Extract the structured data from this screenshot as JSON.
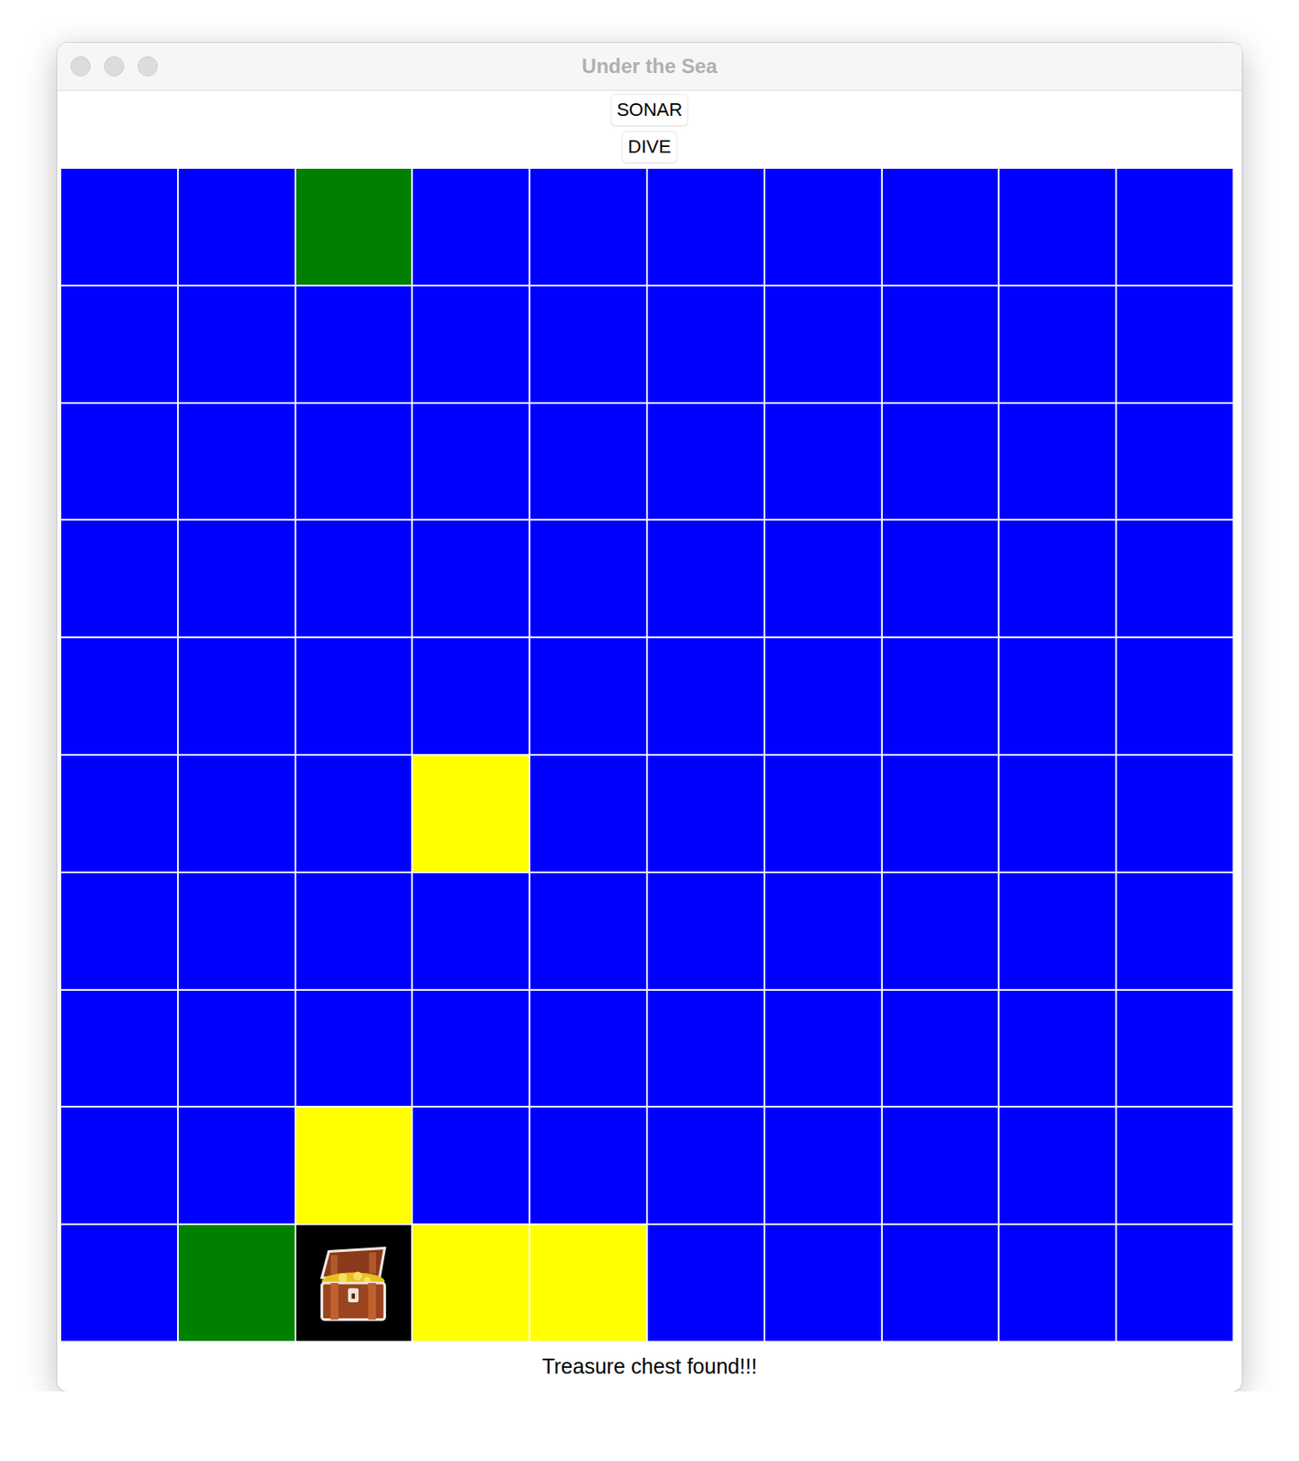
{
  "window": {
    "title": "Under the Sea"
  },
  "buttons": [
    {
      "label": "SONAR"
    },
    {
      "label": "DIVE"
    }
  ],
  "board": {
    "rows": [
      [
        {
          "kind": "water",
          "color": "#0000ff"
        },
        {
          "kind": "water",
          "color": "#0000ff"
        },
        {
          "kind": "water",
          "color": "#008000"
        },
        {
          "kind": "water",
          "color": "#0000ff"
        },
        {
          "kind": "water",
          "color": "#0000ff"
        },
        {
          "kind": "water",
          "color": "#0000ff"
        },
        {
          "kind": "water",
          "color": "#0000ff"
        },
        {
          "kind": "water",
          "color": "#0000ff"
        },
        {
          "kind": "water",
          "color": "#0000ff"
        },
        {
          "kind": "water",
          "color": "#0000ff"
        }
      ],
      [
        {
          "kind": "water",
          "color": "#0000ff"
        },
        {
          "kind": "water",
          "color": "#0000ff"
        },
        {
          "kind": "water",
          "color": "#0000ff"
        },
        {
          "kind": "water",
          "color": "#0000ff"
        },
        {
          "kind": "water",
          "color": "#0000ff"
        },
        {
          "kind": "water",
          "color": "#0000ff"
        },
        {
          "kind": "water",
          "color": "#0000ff"
        },
        {
          "kind": "water",
          "color": "#0000ff"
        },
        {
          "kind": "water",
          "color": "#0000ff"
        },
        {
          "kind": "water",
          "color": "#0000ff"
        }
      ],
      [
        {
          "kind": "water",
          "color": "#0000ff"
        },
        {
          "kind": "water",
          "color": "#0000ff"
        },
        {
          "kind": "water",
          "color": "#0000ff"
        },
        {
          "kind": "water",
          "color": "#0000ff"
        },
        {
          "kind": "water",
          "color": "#0000ff"
        },
        {
          "kind": "water",
          "color": "#0000ff"
        },
        {
          "kind": "water",
          "color": "#0000ff"
        },
        {
          "kind": "water",
          "color": "#0000ff"
        },
        {
          "kind": "water",
          "color": "#0000ff"
        },
        {
          "kind": "water",
          "color": "#0000ff"
        }
      ],
      [
        {
          "kind": "water",
          "color": "#0000ff"
        },
        {
          "kind": "water",
          "color": "#0000ff"
        },
        {
          "kind": "water",
          "color": "#0000ff"
        },
        {
          "kind": "water",
          "color": "#0000ff"
        },
        {
          "kind": "water",
          "color": "#0000ff"
        },
        {
          "kind": "water",
          "color": "#0000ff"
        },
        {
          "kind": "water",
          "color": "#0000ff"
        },
        {
          "kind": "water",
          "color": "#0000ff"
        },
        {
          "kind": "water",
          "color": "#0000ff"
        },
        {
          "kind": "water",
          "color": "#0000ff"
        }
      ],
      [
        {
          "kind": "water",
          "color": "#0000ff"
        },
        {
          "kind": "water",
          "color": "#0000ff"
        },
        {
          "kind": "water",
          "color": "#0000ff"
        },
        {
          "kind": "water",
          "color": "#0000ff"
        },
        {
          "kind": "water",
          "color": "#0000ff"
        },
        {
          "kind": "water",
          "color": "#0000ff"
        },
        {
          "kind": "water",
          "color": "#0000ff"
        },
        {
          "kind": "water",
          "color": "#0000ff"
        },
        {
          "kind": "water",
          "color": "#0000ff"
        },
        {
          "kind": "water",
          "color": "#0000ff"
        }
      ],
      [
        {
          "kind": "water",
          "color": "#0000ff"
        },
        {
          "kind": "water",
          "color": "#0000ff"
        },
        {
          "kind": "water",
          "color": "#0000ff"
        },
        {
          "kind": "water",
          "color": "#ffff00"
        },
        {
          "kind": "water",
          "color": "#0000ff"
        },
        {
          "kind": "water",
          "color": "#0000ff"
        },
        {
          "kind": "water",
          "color": "#0000ff"
        },
        {
          "kind": "water",
          "color": "#0000ff"
        },
        {
          "kind": "water",
          "color": "#0000ff"
        },
        {
          "kind": "water",
          "color": "#0000ff"
        }
      ],
      [
        {
          "kind": "water",
          "color": "#0000ff"
        },
        {
          "kind": "water",
          "color": "#0000ff"
        },
        {
          "kind": "water",
          "color": "#0000ff"
        },
        {
          "kind": "water",
          "color": "#0000ff"
        },
        {
          "kind": "water",
          "color": "#0000ff"
        },
        {
          "kind": "water",
          "color": "#0000ff"
        },
        {
          "kind": "water",
          "color": "#0000ff"
        },
        {
          "kind": "water",
          "color": "#0000ff"
        },
        {
          "kind": "water",
          "color": "#0000ff"
        },
        {
          "kind": "water",
          "color": "#0000ff"
        }
      ],
      [
        {
          "kind": "water",
          "color": "#0000ff"
        },
        {
          "kind": "water",
          "color": "#0000ff"
        },
        {
          "kind": "water",
          "color": "#0000ff"
        },
        {
          "kind": "water",
          "color": "#0000ff"
        },
        {
          "kind": "water",
          "color": "#0000ff"
        },
        {
          "kind": "water",
          "color": "#0000ff"
        },
        {
          "kind": "water",
          "color": "#0000ff"
        },
        {
          "kind": "water",
          "color": "#0000ff"
        },
        {
          "kind": "water",
          "color": "#0000ff"
        },
        {
          "kind": "water",
          "color": "#0000ff"
        }
      ],
      [
        {
          "kind": "water",
          "color": "#0000ff"
        },
        {
          "kind": "water",
          "color": "#0000ff"
        },
        {
          "kind": "water",
          "color": "#ffff00"
        },
        {
          "kind": "water",
          "color": "#0000ff"
        },
        {
          "kind": "water",
          "color": "#0000ff"
        },
        {
          "kind": "water",
          "color": "#0000ff"
        },
        {
          "kind": "water",
          "color": "#0000ff"
        },
        {
          "kind": "water",
          "color": "#0000ff"
        },
        {
          "kind": "water",
          "color": "#0000ff"
        },
        {
          "kind": "water",
          "color": "#0000ff"
        }
      ],
      [
        {
          "kind": "water",
          "color": "#0000ff"
        },
        {
          "kind": "water",
          "color": "#008000"
        },
        {
          "kind": "treasure",
          "color": "#000000"
        },
        {
          "kind": "water",
          "color": "#ffff00"
        },
        {
          "kind": "water",
          "color": "#ffff00"
        },
        {
          "kind": "water",
          "color": "#0000ff"
        },
        {
          "kind": "water",
          "color": "#0000ff"
        },
        {
          "kind": "water",
          "color": "#0000ff"
        },
        {
          "kind": "water",
          "color": "#0000ff"
        },
        {
          "kind": "water",
          "color": "#0000ff"
        }
      ]
    ]
  },
  "status": "Treasure chest found!!!"
}
